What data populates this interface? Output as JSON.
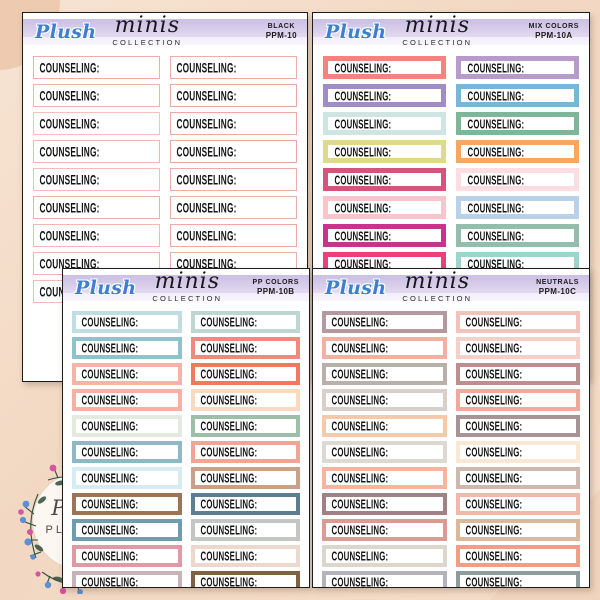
{
  "background": {
    "color": "#f3dcc8",
    "accent": "#eecbb0"
  },
  "watermark": {
    "line1": "Plush",
    "line2": "PLANNER"
  },
  "brand": {
    "name": "Plush",
    "minis": "minis",
    "collection": "COLLECTION",
    "brand_color": "#3f7fd0",
    "band_color": "#cbbfe4"
  },
  "sticker_label": "COUNSELING:",
  "sheets": [
    {
      "id": "sheet-black",
      "sku_name": "BLACK",
      "sku_code": "PPM-10",
      "style": "thin",
      "rows": 9,
      "stickers": [
        {
          "border": "#efada6"
        },
        {
          "border": "#efada6"
        },
        {
          "border": "#f0b2ab"
        },
        {
          "border": "#eda7a0"
        },
        {
          "border": "#f4c2bc"
        },
        {
          "border": "#eeaaa3"
        },
        {
          "border": "#f2b6b0"
        },
        {
          "border": "#eda7a0"
        },
        {
          "border": "#f3bdb7"
        },
        {
          "border": "#efaca5"
        },
        {
          "border": "#f0b0aa"
        },
        {
          "border": "#eeaba4"
        },
        {
          "border": "#f2b8b2"
        },
        {
          "border": "#eda9a2"
        },
        {
          "border": "#f1b4ae"
        },
        {
          "border": "#efaea7"
        },
        {
          "border": "#f3bbb5"
        },
        {
          "border": "#eea9a2"
        }
      ]
    },
    {
      "id": "sheet-mix",
      "sku_name": "MIX COLORS",
      "sku_code": "PPM-10A",
      "style": "thick",
      "rows": 9,
      "stickers": [
        {
          "border": "#f4837f"
        },
        {
          "border": "#b79ccb"
        },
        {
          "border": "#a08cc6"
        },
        {
          "border": "#79b5d6"
        },
        {
          "border": "#cfe5e2"
        },
        {
          "border": "#7fb598"
        },
        {
          "border": "#ddd98d"
        },
        {
          "border": "#f5a765"
        },
        {
          "border": "#d4547d"
        },
        {
          "border": "#fbdde2"
        },
        {
          "border": "#f9c4cc"
        },
        {
          "border": "#b9d2ea"
        },
        {
          "border": "#c9338c"
        },
        {
          "border": "#94bdae"
        },
        {
          "border": "#ec3f7a"
        },
        {
          "border": "#9ed5cb"
        },
        {
          "border": "#3f63a8"
        },
        {
          "border": "#8a8a52"
        }
      ]
    },
    {
      "id": "sheet-pp",
      "sku_name": "PP COLORS",
      "sku_code": "PPM-10B",
      "style": "med",
      "rows": 11,
      "stickers": [
        {
          "border": "#bfdde3"
        },
        {
          "border": "#bdd6cf"
        },
        {
          "border": "#8fc2cc"
        },
        {
          "border": "#f08a7e"
        },
        {
          "border": "#f6b4a8"
        },
        {
          "border": "#f2785f"
        },
        {
          "border": "#f9afa4"
        },
        {
          "border": "#fad9bf"
        },
        {
          "border": "#e3ebe0"
        },
        {
          "border": "#9dbfa9"
        },
        {
          "border": "#8fb7c6"
        },
        {
          "border": "#f2a597"
        },
        {
          "border": "#d6ecf0"
        },
        {
          "border": "#c9a189"
        },
        {
          "border": "#9c7456"
        },
        {
          "border": "#5d7d91"
        },
        {
          "border": "#6f9db0"
        },
        {
          "border": "#c3c6c2"
        },
        {
          "border": "#e09aa4"
        },
        {
          "border": "#ecd8cd"
        },
        {
          "border": "#c8b2b8"
        },
        {
          "border": "#7d6243"
        }
      ]
    },
    {
      "id": "sheet-neutrals",
      "sku_name": "NEUTRALS",
      "sku_code": "PPM-10C",
      "style": "med",
      "rows": 11,
      "stickers": [
        {
          "border": "#b49aa0"
        },
        {
          "border": "#f3c3bb"
        },
        {
          "border": "#f2b0a1"
        },
        {
          "border": "#f6cfc8"
        },
        {
          "border": "#b9b0ac"
        },
        {
          "border": "#bb8f90"
        },
        {
          "border": "#d9cec9"
        },
        {
          "border": "#f4a79b"
        },
        {
          "border": "#f8c9a8"
        },
        {
          "border": "#a89496"
        },
        {
          "border": "#ddd8d0"
        },
        {
          "border": "#fbe7d2"
        },
        {
          "border": "#f6b59f"
        },
        {
          "border": "#cfb9ae"
        },
        {
          "border": "#9f8285"
        },
        {
          "border": "#f0b8aa"
        },
        {
          "border": "#dd9a95"
        },
        {
          "border": "#dcb79a"
        },
        {
          "border": "#ddd6cd"
        },
        {
          "border": "#f29d88"
        },
        {
          "border": "#b4b3bd"
        },
        {
          "border": "#8e9d9c"
        }
      ]
    }
  ]
}
